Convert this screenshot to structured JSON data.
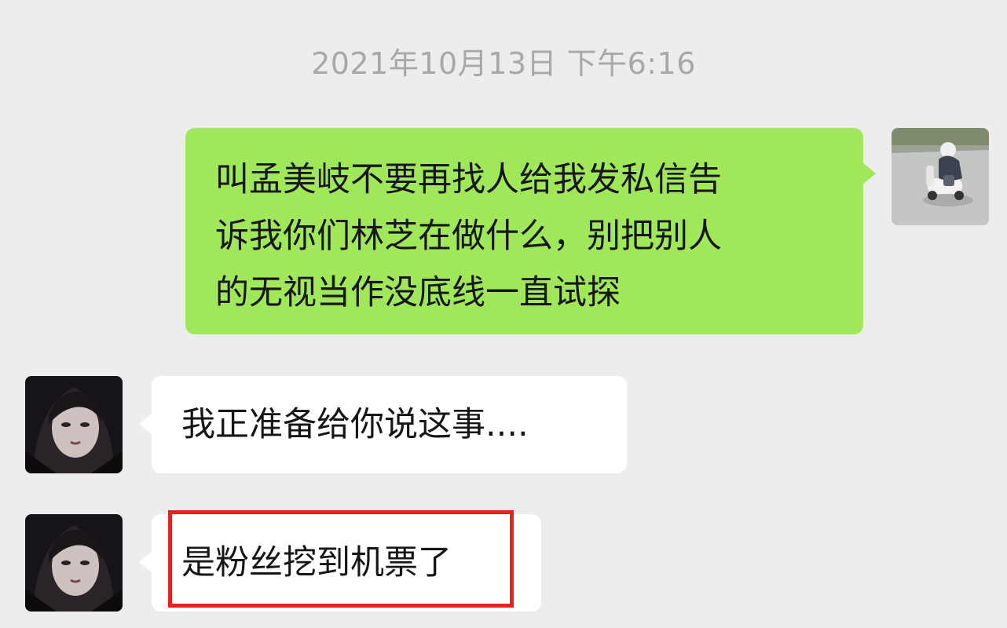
{
  "chat": {
    "timestamp": "2021年10月13日 下午6:16",
    "messages": [
      {
        "sender": "me",
        "lines": [
          "叫孟美岐不要再找人给我发私信告",
          "诉我你们林芝在做什么，别把别人",
          "的无视当作没底线一直试探"
        ]
      },
      {
        "sender": "other",
        "lines": [
          "我正准备给你说这事...."
        ]
      },
      {
        "sender": "other",
        "lines": [
          "是粉丝挖到机票了"
        ]
      }
    ]
  },
  "icons": {
    "my_avatar": "scooter-photo-avatar",
    "other_avatar": "portrait-photo-avatar"
  },
  "colors": {
    "background": "#ededed",
    "sent_bubble": "#a0e75a",
    "received_bubble": "#ffffff",
    "highlight_box": "#e8211e",
    "timestamp_text": "#a8a8a8"
  }
}
